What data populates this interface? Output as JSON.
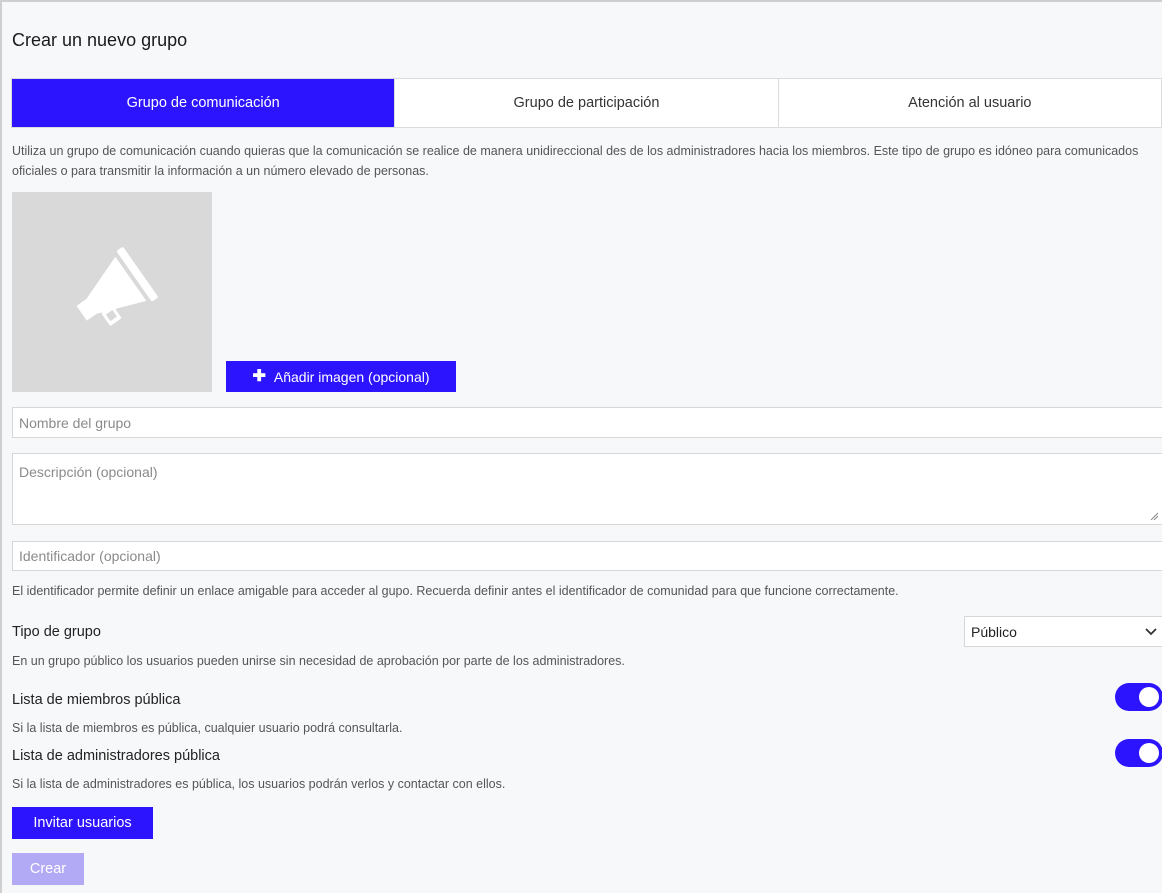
{
  "page": {
    "title": "Crear un nuevo grupo"
  },
  "tabs": [
    {
      "label": "Grupo de comunicación",
      "active": true
    },
    {
      "label": "Grupo de participación",
      "active": false
    },
    {
      "label": "Atención al usuario",
      "active": false
    }
  ],
  "description": "Utiliza un grupo de comunicación cuando quieras que la comunicación se realice de manera unidireccional des de los administradores hacia los miembros. Este tipo de grupo es idóneo para comunicados oficiales o para transmitir la información a un número elevado de personas.",
  "image": {
    "icon": "megaphone-icon",
    "add_button_label": "Añadir imagen (opcional)"
  },
  "form": {
    "name_placeholder": "Nombre del grupo",
    "description_placeholder": "Descripción (opcional)",
    "identifier_placeholder": "Identificador (opcional)",
    "identifier_help": "El identificador permite definir un enlace amigable para acceder al gupo. Recuerda definir antes el identificador de comunidad para que funcione correctamente.",
    "group_type_label": "Tipo de grupo",
    "group_type_value": "Público",
    "group_type_help": "En un grupo público los usuarios pueden unirse sin necesidad de aprobación por parte de los administradores.",
    "members_public_label": "Lista de miembros pública",
    "members_public_help": "Si la lista de miembros es pública, cualquier usuario podrá consultarla.",
    "members_public_on": true,
    "admins_public_label": "Lista de administradores pública",
    "admins_public_help": "Si la lista de administradores es pública, los usuarios podrán verlos y contactar con ellos.",
    "admins_public_on": true
  },
  "buttons": {
    "invite": "Invitar usuarios",
    "create": "Crear"
  },
  "colors": {
    "accent": "#2d14ff",
    "disabled": "#b3aaf5",
    "placeholder_bg": "#d9d9d9"
  }
}
